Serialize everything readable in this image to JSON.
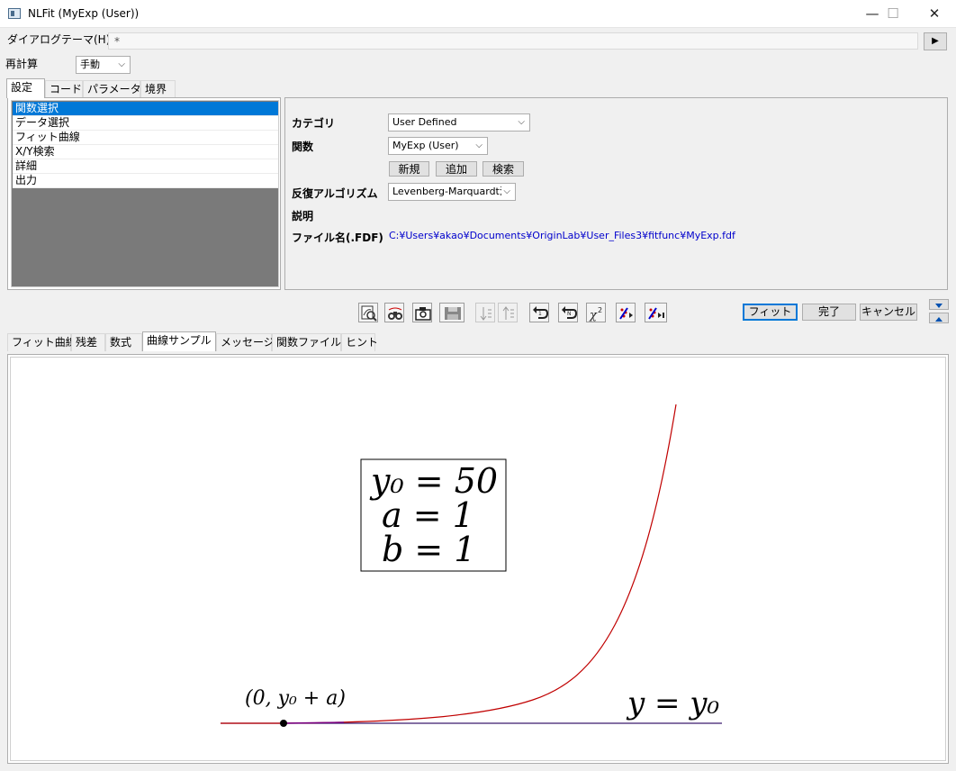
{
  "window": {
    "title": "NLFit (MyExp (User))",
    "minimize_glyph": "—",
    "maximize_glyph": "☐",
    "close_glyph": "✕"
  },
  "theme": {
    "label": "ダイアログテーマ(H)",
    "value": "*",
    "arrow_glyph": "▶"
  },
  "recalc": {
    "label": "再計算",
    "value": "手動"
  },
  "top_tabs": [
    "設定",
    "コード",
    "パラメータ",
    "境界"
  ],
  "tree": {
    "items": [
      "関数選択",
      "データ選択",
      "フィット曲線",
      "X/Y検索",
      "詳細",
      "出力"
    ]
  },
  "settings": {
    "category_label": "カテゴリ",
    "category_value": "User Defined",
    "function_label": "関数",
    "function_value": "MyExp (User)",
    "buttons": [
      "新規",
      "追加",
      "検索"
    ],
    "algorithm_label": "反復アルゴリズム",
    "algorithm_value": "Levenberg-Marquardt法",
    "description_label": "説明",
    "filename_label": "ファイル名(.FDF)",
    "filename_value": "C:¥Users¥akao¥Documents¥OriginLab¥User_Files3¥fitfunc¥MyExp.fdf"
  },
  "actions": {
    "fit": "フィット",
    "done": "完了",
    "cancel": "キャンセル"
  },
  "toolbar_icons": [
    "preview-fit-icon",
    "binocular-icon",
    "camera-icon",
    "save-icon",
    "sort-down-icon",
    "sort-up-icon",
    "undo-icon",
    "redo-icon",
    "chi-square-icon",
    "fit-one-iteration-icon",
    "fit-until-converge-icon"
  ],
  "bottom_tabs": [
    "フィット曲線",
    "残差",
    "数式",
    "曲線サンプル",
    "メッセージ",
    "関数ファイル",
    "ヒント"
  ],
  "sample": {
    "param_y0": "y₀ = 50",
    "param_a": "a = 1",
    "param_b": "b = 1",
    "point_label": "(0, y₀ + a)",
    "asymptote_label": "y = y₀"
  },
  "colors": {
    "selection": "#0078d7",
    "curve": "#c00000",
    "asymptote": "#3a1a6e",
    "link": "#0000cc",
    "fit_button_border": "#0078d7"
  }
}
